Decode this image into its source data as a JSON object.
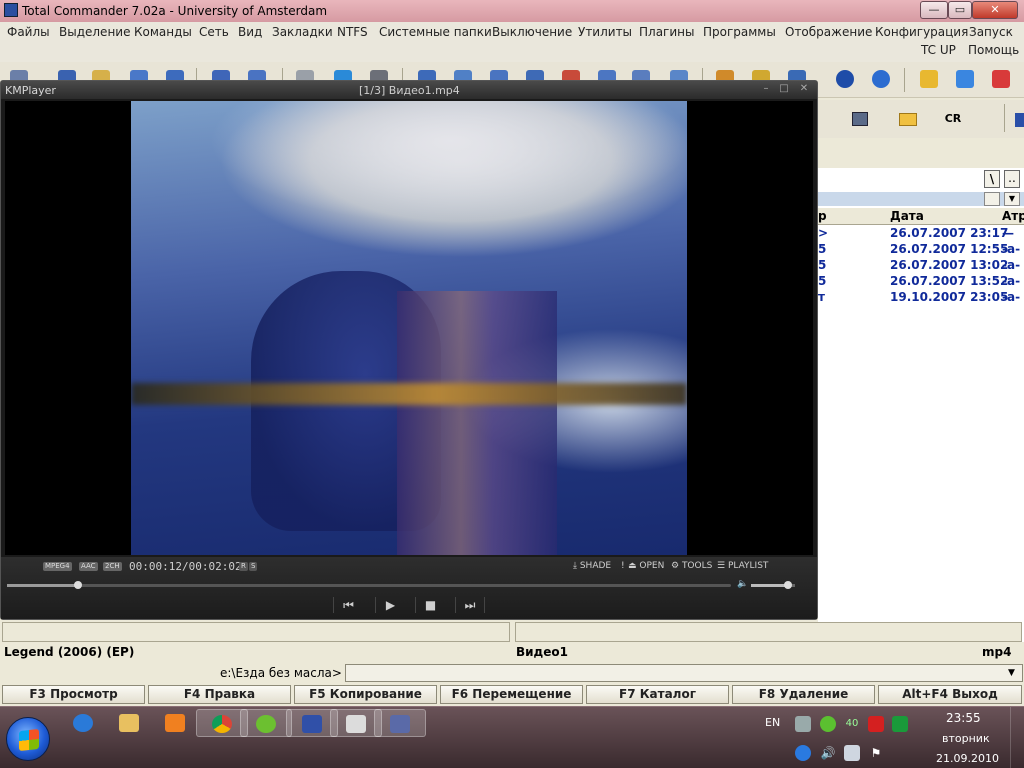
{
  "tc": {
    "title": "Total Commander 7.02a - University of Amsterdam",
    "window_buttons": {
      "minimize": "—",
      "maximize": "▭",
      "close": "✕"
    },
    "menu": [
      "Файлы",
      "Выделение",
      "Команды",
      "Сеть",
      "Вид",
      "Закладки",
      "NTFS",
      "Системные папки",
      "Выключение",
      "Утилиты",
      "Плагины",
      "Программы",
      "Отображение",
      "Конфигурация",
      "Запуск",
      "TC UP",
      "Помощь"
    ],
    "toolbar2_cr": "CR",
    "right_panel": {
      "drive_buttons": [
        "\\",
        ".."
      ],
      "columns": {
        "name_tail": "р",
        "date": "Дата",
        "attr": "Атр"
      },
      "rows": [
        {
          "name_tail": ">",
          "date": "26.07.2007 23:17",
          "attr": "—"
        },
        {
          "name_tail": "5",
          "date": "26.07.2007 12:55",
          "attr": "-a-"
        },
        {
          "name_tail": "5",
          "date": "26.07.2007 13:02",
          "attr": "-a-"
        },
        {
          "name_tail": "5",
          "date": "26.07.2007 13:52",
          "attr": "-a-"
        },
        {
          "name_tail": "т",
          "date": "19.10.2007 23:05",
          "attr": "-a-"
        }
      ]
    },
    "info_left": "Legend (2006) (EP)",
    "info_file": "Видео1",
    "info_ext": "mp4",
    "cmd_prompt": "e:\\Езда без масла>",
    "cmd_value": "",
    "fkeys": [
      "F3 Просмотр",
      "F4 Правка",
      "F5 Копирование",
      "F6 Перемещение",
      "F7 Каталог",
      "F8 Удаление",
      "Alt+F4 Выход"
    ]
  },
  "kmplayer": {
    "logo": "KMPlayer",
    "file_title": "[1/3] Видео1.mp4",
    "window_buttons": {
      "min": "–",
      "max": "□",
      "close": "✕"
    },
    "badges": [
      "MPEG4",
      "AAC",
      "2CH"
    ],
    "time": "00:00:12/00:02:02",
    "rs": [
      "R",
      "S"
    ],
    "controls": {
      "shade": "SHADE",
      "open": "OPEN",
      "tools": "TOOLS",
      "playlist": "PLAYLIST"
    },
    "seek_position": 0.098,
    "volume_level": 0.85,
    "transport": {
      "prev": "⏮",
      "play": "▶",
      "stop": "■",
      "next": "⏭"
    }
  },
  "taskbar": {
    "lang": "EN",
    "tray_badge": "40",
    "clock_time": "23:55",
    "clock_day": "вторник",
    "clock_date": "21.09.2010"
  }
}
